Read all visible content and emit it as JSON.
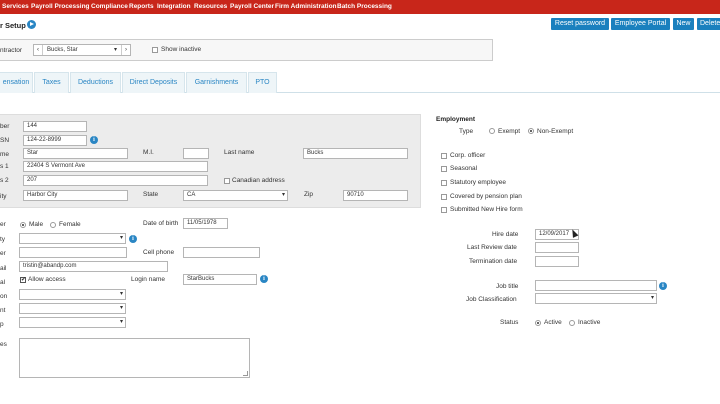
{
  "topnav": {
    "items": [
      "Services",
      "Payroll Processing",
      "Compliance",
      "Reports",
      "Integration",
      "Resources",
      "Payroll Center",
      "Firm Administration",
      "Batch Processing"
    ]
  },
  "header": {
    "title": "r Setup",
    "buttons": [
      "Reset password",
      "Employee Portal",
      "New",
      "Delete"
    ]
  },
  "contractor": {
    "label": "ntractor",
    "selected": "Bucks, Star",
    "show_inactive_label": "Show inactive"
  },
  "tabs": [
    "ensation",
    "Taxes",
    "Deductions",
    "Direct Deposits",
    "Garnishments",
    "PTO"
  ],
  "identity": {
    "number_label": "ber",
    "number_value": "144",
    "ssn_label": "SN",
    "ssn_value": "124-22-8999",
    "first_label": "me",
    "first_value": "Star",
    "mi_label": "M.I.",
    "mi_value": "",
    "last_label": "Last name",
    "last_value": "Bucks",
    "addr1_label": "s 1",
    "addr1_value": "22404 S Vermont Ave",
    "addr2_label": "s 2",
    "addr2_value": "207",
    "canadian_label": "Canadian address",
    "city_label": "ity",
    "city_value": "Harbor City",
    "state_label": "State",
    "state_value": "CA",
    "zip_label": "Zip",
    "zip_value": "90710"
  },
  "personal": {
    "gender_label": "er",
    "male_label": "Male",
    "female_label": "Female",
    "dob_label": "Date of birth",
    "dob_value": "11/05/1978",
    "row2_label": "ty",
    "row3_label": "er",
    "cell_label": "Cell phone",
    "email_label": "ail",
    "email_value": "tristin@abandp.com",
    "access_row_label": "al",
    "allow_access_label": "Allow access",
    "login_label": "Login name",
    "login_value": "StarBucks",
    "row6_label": "on",
    "row7_label": "nt",
    "row8_label": "p",
    "notes_label": "es"
  },
  "employment": {
    "heading": "Employment",
    "type_label": "Type",
    "exempt_label": "Exempt",
    "nonexempt_label": "Non-Exempt",
    "checkboxes": [
      "Corp. officer",
      "Seasonal",
      "Statutory employee",
      "Covered by pension plan",
      "Submitted New Hire form"
    ],
    "hire_label": "Hire date",
    "hire_value": "12/09/2017",
    "review_label": "Last Review date",
    "termination_label": "Termination date",
    "job_title_label": "Job title",
    "job_class_label": "Job Classification",
    "status_label": "Status",
    "active_label": "Active",
    "inactive_label": "Inactive"
  },
  "colors": {
    "nav": "#c8261a",
    "accent": "#1a80be"
  }
}
